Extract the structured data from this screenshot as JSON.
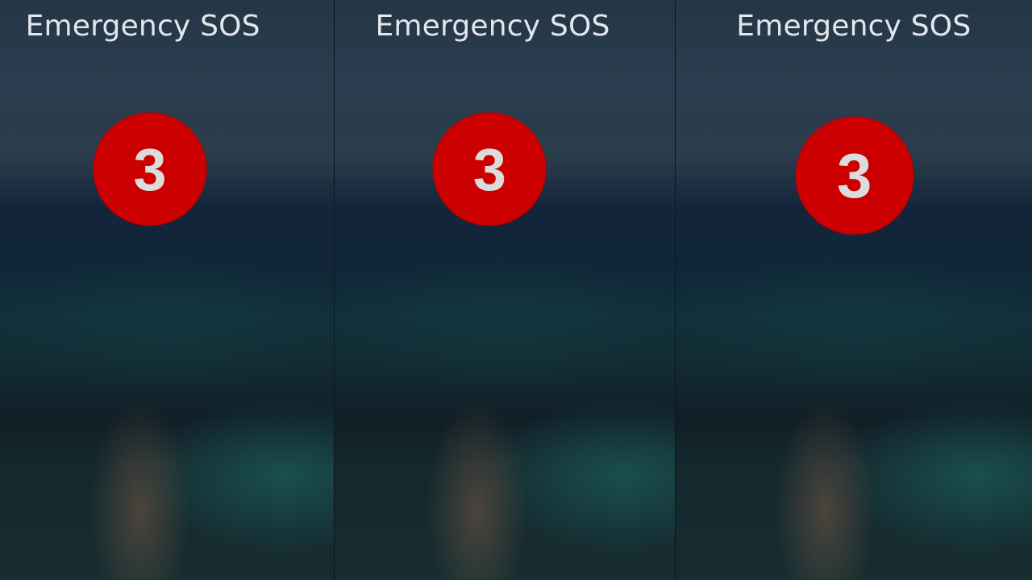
{
  "panels": [
    {
      "title": "Emergency SOS",
      "countdown": "3"
    },
    {
      "title": "Emergency SOS",
      "countdown": "3"
    },
    {
      "title": "Emergency SOS",
      "countdown": "3"
    }
  ],
  "colors": {
    "countdown_circle": "#cc0000",
    "countdown_digit": "#dcdcdc",
    "title_text": "#e3e6ea"
  }
}
